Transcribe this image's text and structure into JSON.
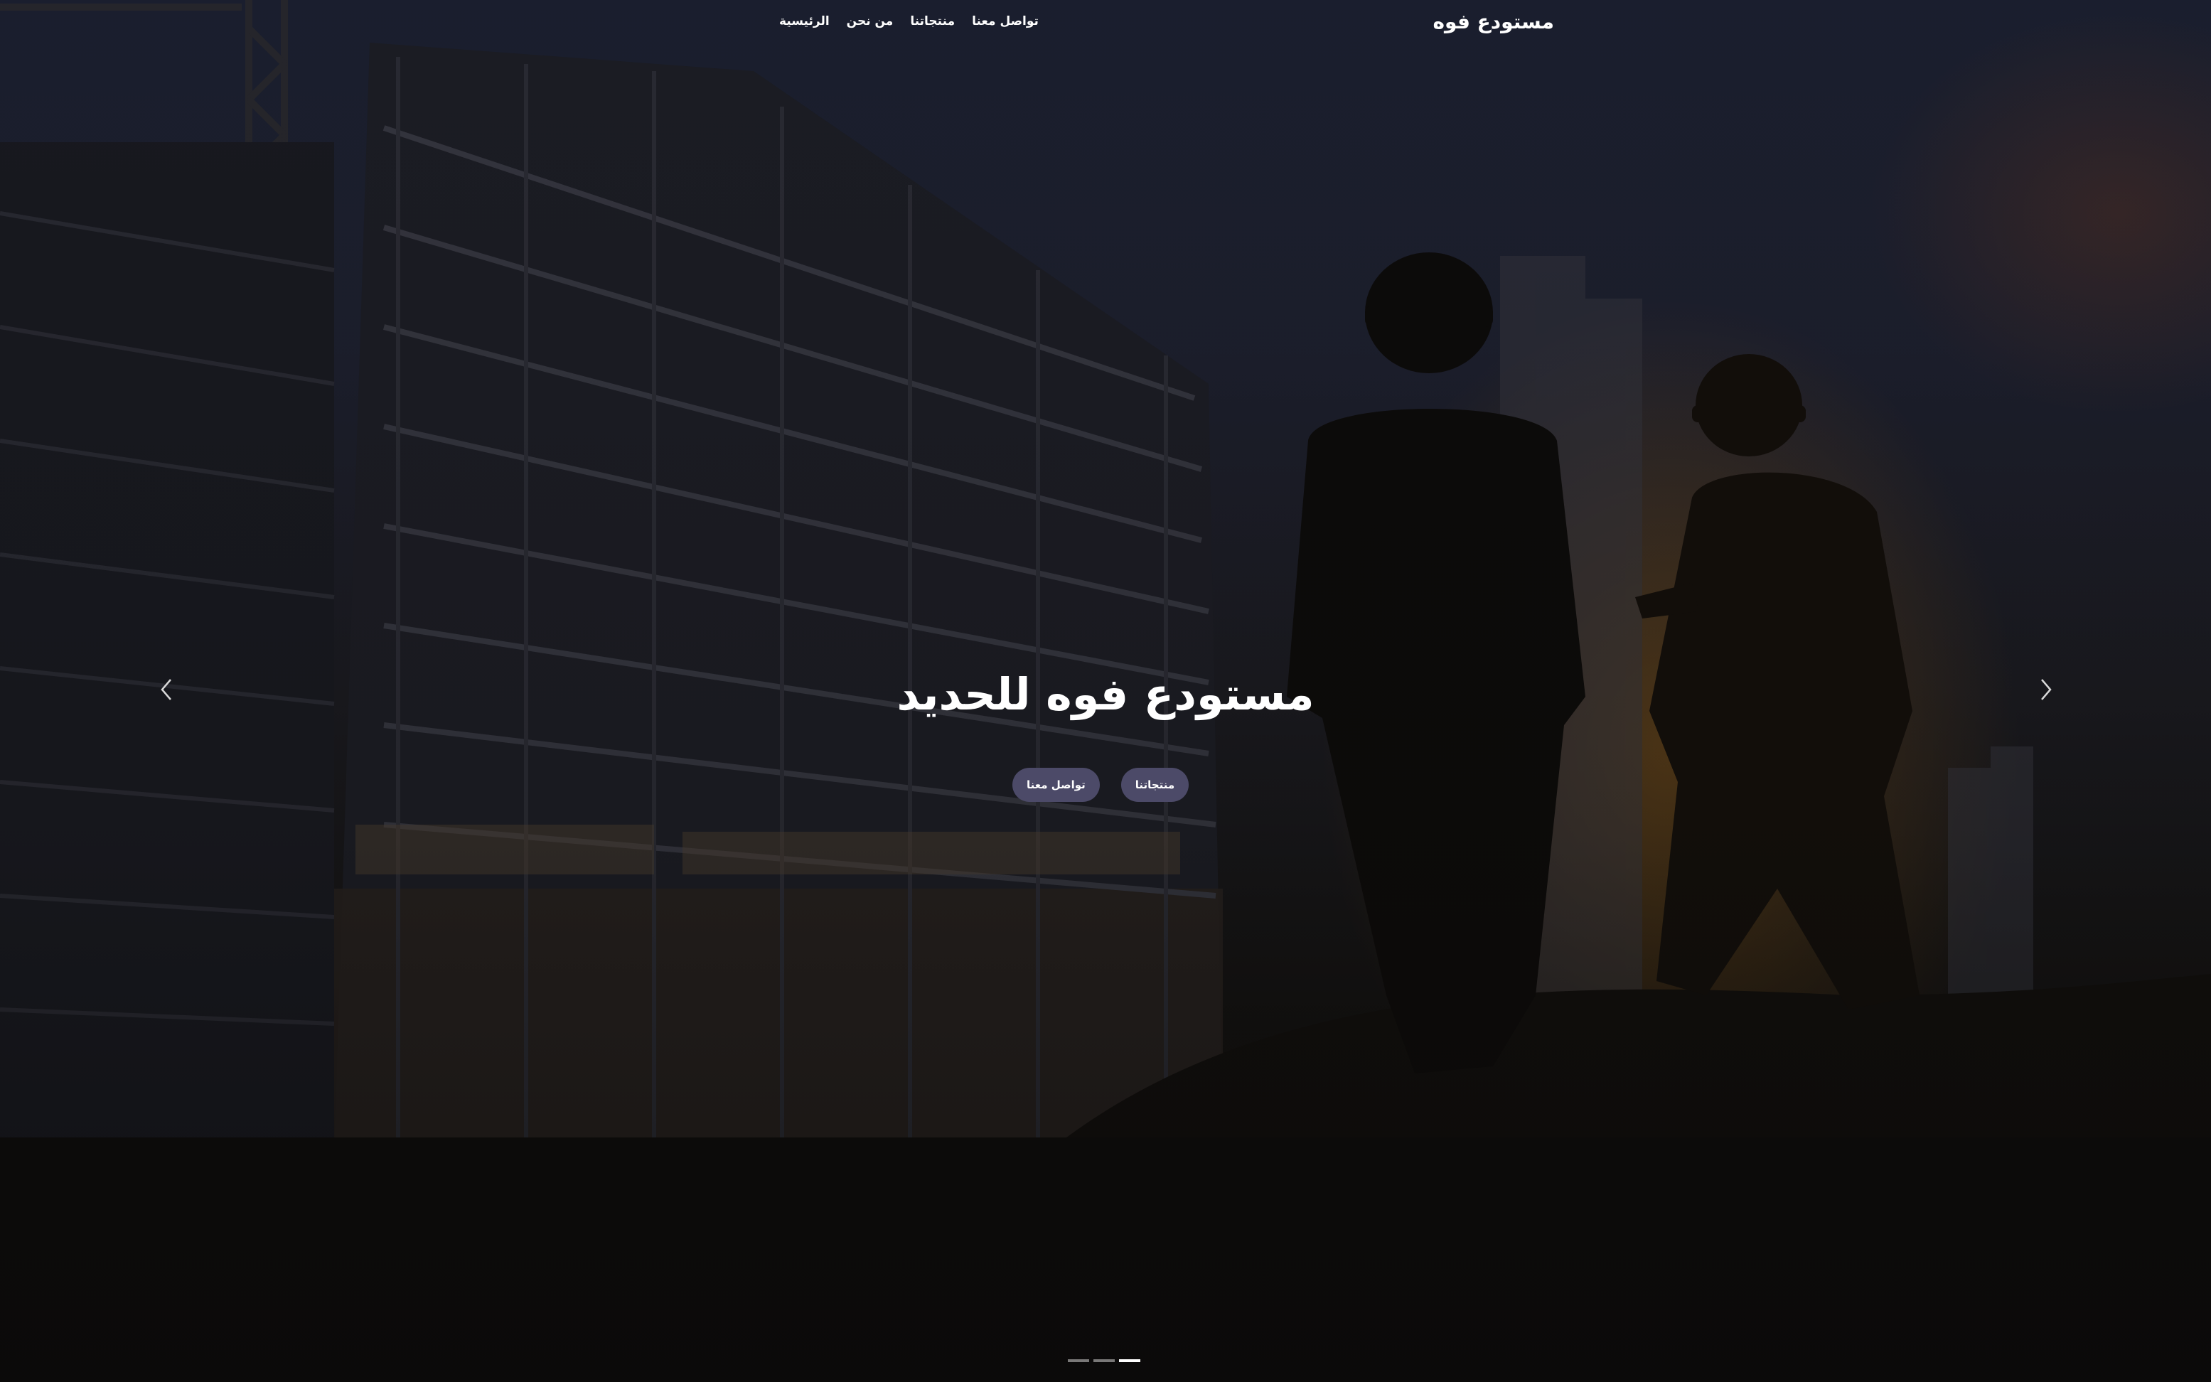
{
  "navbar": {
    "brand": "مستودع فوه",
    "links": [
      {
        "label": "الرئيسية"
      },
      {
        "label": "من نحن"
      },
      {
        "label": "منتجاتنا"
      },
      {
        "label": "تواصل معنا"
      }
    ]
  },
  "hero": {
    "title": "مستودع فوه للحديد",
    "buttons": {
      "contact_label": "تواصل معنا",
      "products_label": "منتجاتنا"
    }
  },
  "carousel": {
    "prev_icon": "chevron-left-icon",
    "next_icon": "chevron-right-icon",
    "slides_count": 3,
    "active_slide": 1
  },
  "colors": {
    "button_bg": "#4c4a68",
    "text": "#ffffff"
  }
}
